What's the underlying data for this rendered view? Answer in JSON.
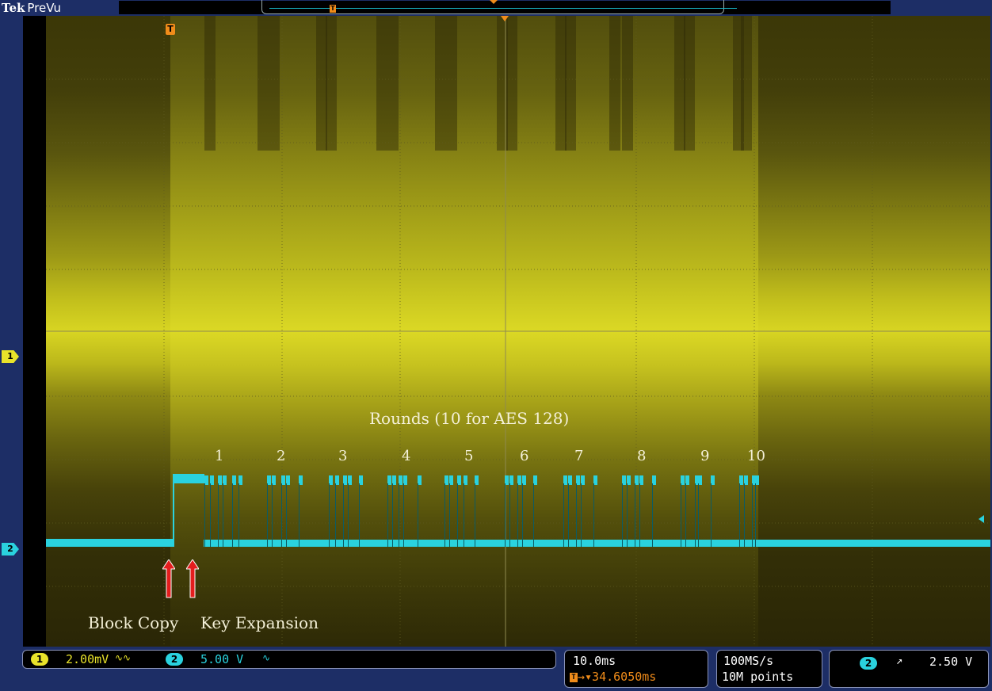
{
  "header": {
    "brand": "Tek",
    "mode": "PreVu",
    "record_trigger_tag": "T"
  },
  "screen": {
    "trigger_tag": "T",
    "channel1_marker": "1",
    "channel2_marker": "2",
    "annotations": {
      "rounds_title": "Rounds (10 for AES 128)",
      "round_numbers": [
        "1",
        "2",
        "3",
        "4",
        "5",
        "6",
        "7",
        "8",
        "9",
        "10"
      ],
      "block_copy": "Block Copy",
      "key_expansion": "Key Expansion"
    },
    "colors": {
      "ch1_trace": "#e9e32a",
      "ch2_trace": "#2ad2de",
      "trigger": "#f08c1a",
      "arrows": "#e41d1d"
    }
  },
  "status": {
    "ch1": {
      "badge": "1",
      "scale": "2.00mV",
      "coupling": "∿∿"
    },
    "ch2": {
      "badge": "2",
      "scale": "5.00 V",
      "coupling": "∿"
    },
    "horizontal": {
      "scale": "10.0ms",
      "trigger_tag": "T",
      "delay": "→▾34.6050ms"
    },
    "acquisition": {
      "sample_rate": "100MS/s",
      "record_length": "10M points"
    },
    "trigger": {
      "source_badge": "2",
      "slope": "↗",
      "level": "2.50 V"
    }
  }
}
